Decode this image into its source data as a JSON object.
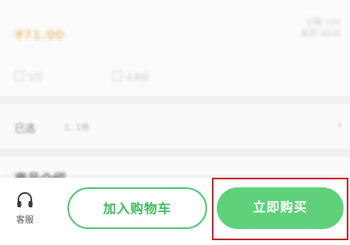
{
  "product": {
    "price": "¥71.00",
    "meta_top": "已售 120",
    "meta_bottom": "库存 6608",
    "stat_left": "1万",
    "stat_right": "4.8分"
  },
  "selection": {
    "label": "已选",
    "value": "1, 1件"
  },
  "section": {
    "title": "商品介绍"
  },
  "bottom_bar": {
    "service_label": "客服",
    "add_to_cart_label": "加入购物车",
    "buy_now_label": "立即购买"
  },
  "colors": {
    "accent": "#4cc46d",
    "buy_button": "#5ed17a",
    "highlight": "#c3222a"
  },
  "icons": {
    "service": "headset-icon",
    "chevron": "chevron-right-icon"
  }
}
